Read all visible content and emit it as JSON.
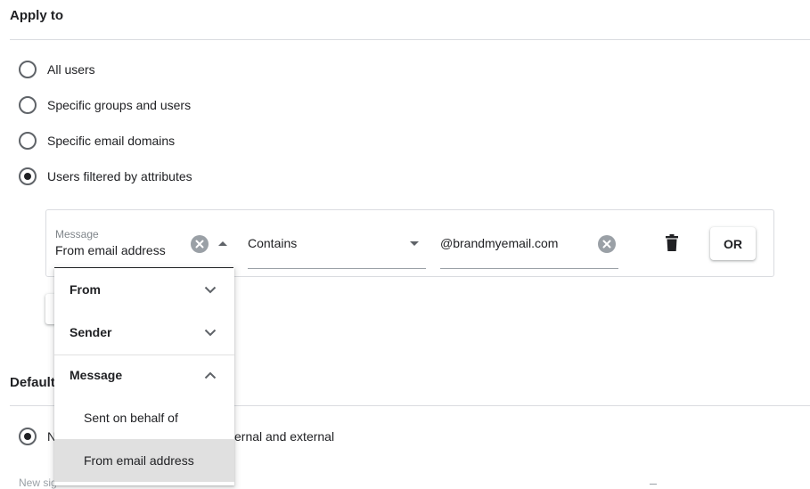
{
  "apply_to": {
    "title": "Apply to",
    "options": [
      {
        "label": "All users",
        "checked": false
      },
      {
        "label": "Specific groups and users",
        "checked": false
      },
      {
        "label": "Specific email domains",
        "checked": false
      },
      {
        "label": "Users filtered by attributes",
        "checked": true
      }
    ]
  },
  "filter": {
    "attribute_label": "Message",
    "attribute_value": "From email address",
    "operator_value": "Contains",
    "match_value": "@brandmyemail.com",
    "or_label": "OR"
  },
  "dropdown": {
    "groups": [
      {
        "label": "From",
        "expanded": false
      },
      {
        "label": "Sender",
        "expanded": false
      },
      {
        "label": "Message",
        "expanded": true
      }
    ],
    "items": [
      {
        "label": "Sent on behalf of",
        "selected": false
      },
      {
        "label": "From email address",
        "selected": true
      }
    ]
  },
  "default_section": {
    "title_partial": "Default",
    "radio_partial": "N",
    "radio_tail": "ernal and external",
    "radio_checked": true,
    "footnote_partial": "New sig"
  },
  "colors": {
    "selected_bg": "#e0e0e0",
    "border": "#dadce0",
    "text": "#202124"
  },
  "icons": [
    "clear-icon",
    "caret-up-icon",
    "caret-down-icon",
    "trash-icon",
    "chevron-down-icon",
    "chevron-up-icon"
  ]
}
